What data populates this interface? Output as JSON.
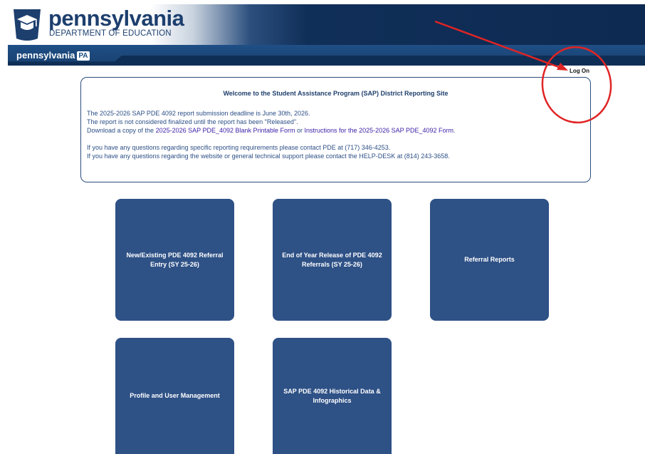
{
  "header": {
    "brand_name": "pennsylvania",
    "department": "DEPARTMENT OF EDUCATION",
    "sub_logo": "pennsylvania",
    "pa_badge": "PA"
  },
  "nav": {
    "logon": "Log On"
  },
  "welcome": {
    "title": "Welcome to the Student Assistance Program (SAP) District Reporting Site",
    "deadline": "The 2025-2026 SAP PDE 4092 report submission deadline is June 30th, 2026.",
    "finalized": "The report is not considered finalized until the report has been \"Released\".",
    "download_prefix": "Download a copy of the ",
    "blank_form_link": "2025-2026 SAP PDE_4092 Blank Printable Form",
    "download_or": " or ",
    "instructions_link": "Instructions for the 2025-2026 SAP PDE_4092 Form",
    "download_suffix": ".",
    "contact_pde": "If you have any questions regarding specific reporting requirements please contact PDE at (717) 346-4253.",
    "contact_helpdesk": "If you have any questions regarding the website or general technical support please contact the HELP-DESK at (814) 243-3658."
  },
  "tiles": [
    {
      "label": "New/Existing PDE 4092 Referral Entry (SY 25-26)"
    },
    {
      "label": "End of Year Release of PDE 4092 Referrals (SY 25-26)"
    },
    {
      "label": "Referral Reports"
    },
    {
      "label": "Profile and User Management"
    },
    {
      "label": "SAP PDE 4092 Historical Data & Infographics"
    }
  ],
  "colors": {
    "navy": "#0d2a52",
    "tile_blue": "#2e5186",
    "annotation_red": "#e02424",
    "link_purple": "#3b1fa6"
  },
  "icons": {
    "keystone": "keystone-logo-icon"
  }
}
